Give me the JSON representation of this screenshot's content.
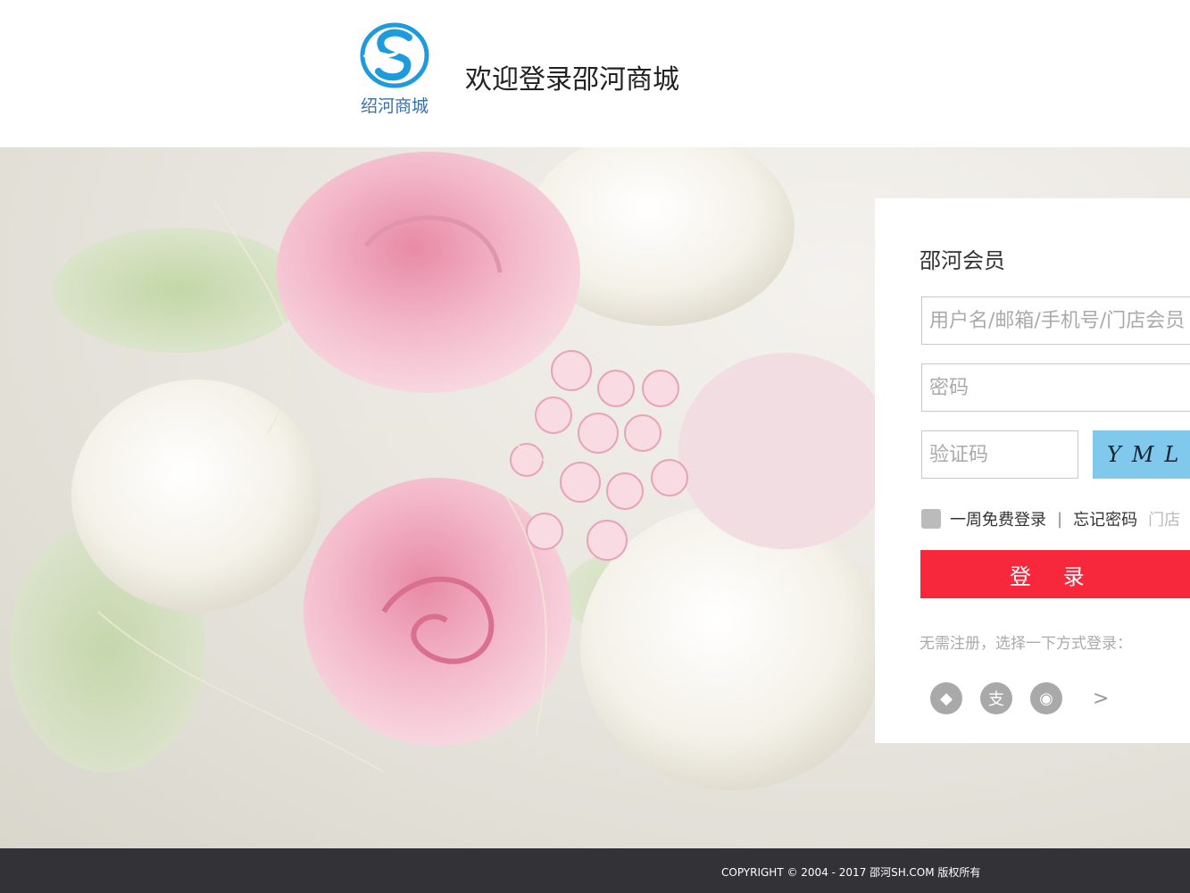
{
  "header": {
    "logo_text": "绍河商城",
    "welcome": "欢迎登录邵河商城"
  },
  "login": {
    "title": "邵河会员",
    "username_placeholder": "用户名/邮箱/手机号/门店会员",
    "password_placeholder": "密码",
    "captcha_placeholder": "验证码",
    "captcha_text": "YML",
    "remember_label": "一周免费登录",
    "forgot_label": "忘记密码",
    "store_label": "门店",
    "submit_label": "登 录",
    "alt_login_text": "无需注册，选择一下方式登录：",
    "social": [
      {
        "icon": "qq-icon",
        "glyph": "◆"
      },
      {
        "icon": "alipay-icon",
        "glyph": "支"
      },
      {
        "icon": "wechat-icon",
        "glyph": "◉"
      }
    ],
    "more_label": ">"
  },
  "footer": {
    "copyright": "COPYRIGHT © 2004 - 2017  邵河SH.COM 版权所有"
  },
  "colors": {
    "primary_red": "#f7283c",
    "captcha_bg": "#80c8ec",
    "footer_bg": "#333237",
    "logo_blue": "#1d9bdc"
  }
}
